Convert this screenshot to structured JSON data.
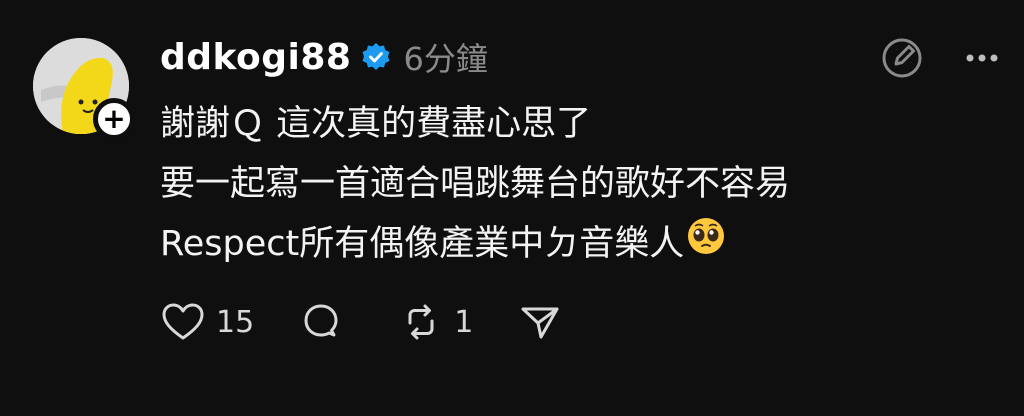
{
  "post": {
    "author": {
      "username": "ddkogi88",
      "verified": true,
      "avatar_icon": "yellow-character-avatar",
      "follow_badge": "+"
    },
    "timestamp": "6分鐘",
    "lines": [
      "謝謝Ｑ 這次真的費盡心思了",
      "要一起寫一首適合唱跳舞台的歌好不容易",
      "Respect所有偶像產業中ㄉ音樂人"
    ],
    "emoji": "pleading-face-emoji",
    "actions": {
      "like_count": "15",
      "reply_count": "",
      "repost_count": "1"
    },
    "icons": {
      "top": [
        "edit-circle-icon",
        "more-icon"
      ],
      "bottom": [
        "heart-icon",
        "comment-icon",
        "repost-icon",
        "share-icon"
      ]
    }
  },
  "colors": {
    "background": "#0f0f0f",
    "text": "#f3f3f3",
    "muted": "#8a8a8a",
    "verified": "#1d9bf0",
    "avatar_yellow": "#f3d81a"
  }
}
